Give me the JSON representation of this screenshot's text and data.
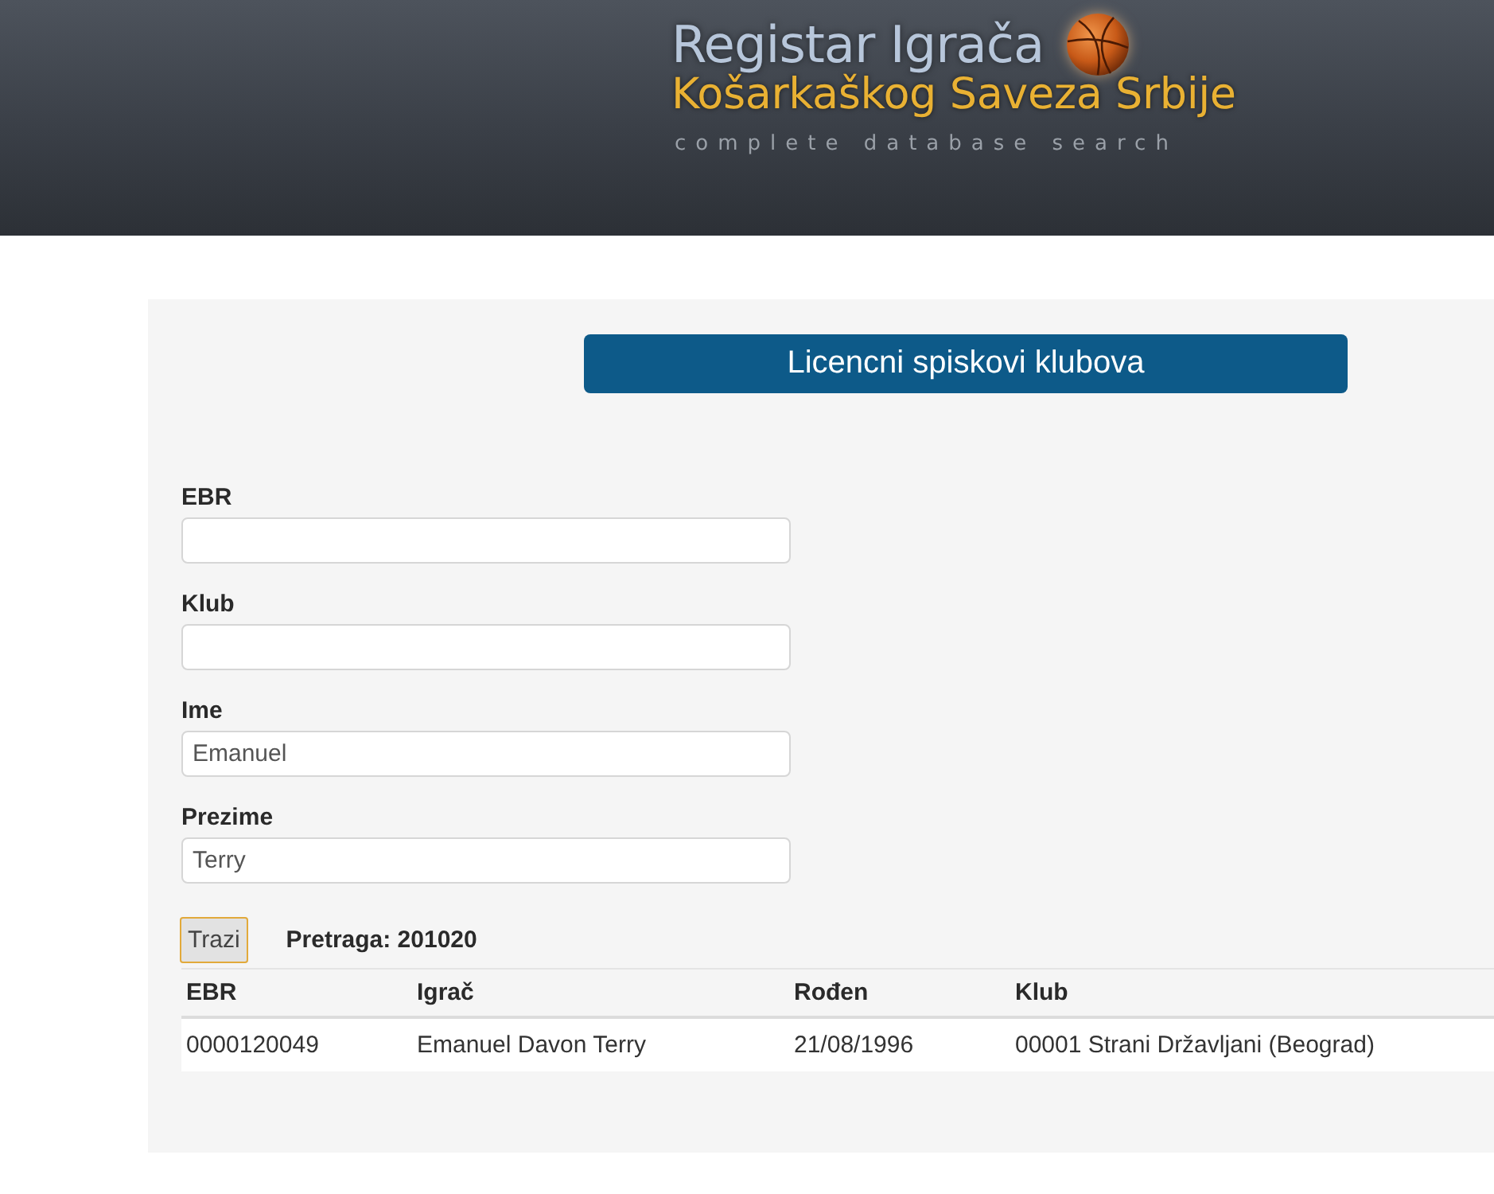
{
  "header": {
    "title": "Registar Igrača",
    "subtitle": "Košarkaškog Saveza Srbije",
    "tagline": "complete database search"
  },
  "panel": {
    "heading": "Licencni spiskovi klubova",
    "fields": [
      {
        "label": "EBR"
      },
      {
        "label": "Klub"
      },
      {
        "label": "Ime",
        "value": "Emanuel"
      },
      {
        "label": "Prezime",
        "value": "Terry"
      }
    ],
    "search_button": "Trazi",
    "search_info": "Pretraga: 201020",
    "table": {
      "columns": [
        "EBR",
        "Igrač",
        "Rođen",
        "Klub"
      ],
      "rows": [
        [
          "0000120049",
          "Emanuel Davon Terry",
          "21/08/1996",
          "00001 Strani Državljani (Beograd)"
        ]
      ]
    }
  }
}
